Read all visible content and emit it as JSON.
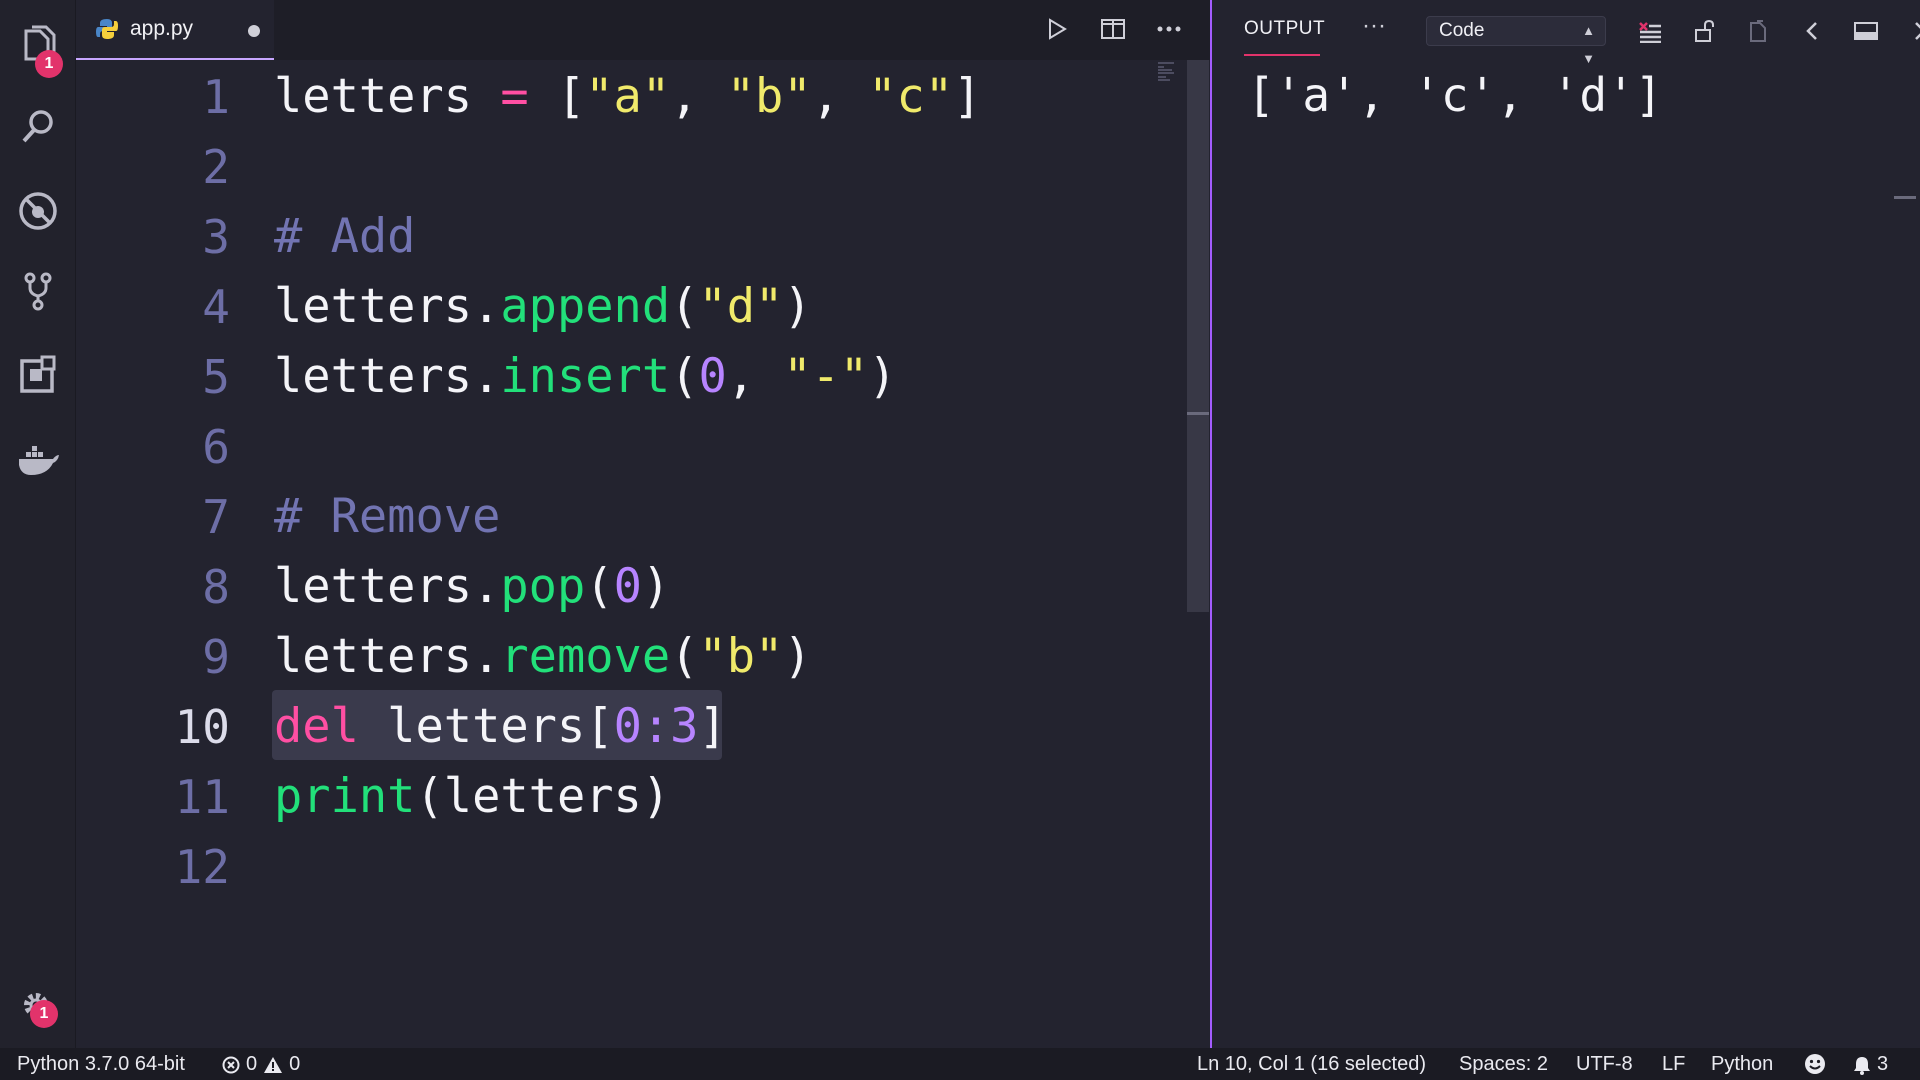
{
  "activity_bar": {
    "explorer_badge": "1",
    "settings_badge": "1",
    "items": [
      "files-icon",
      "search-icon",
      "debug-icon",
      "source-control-icon",
      "extensions-icon",
      "docker-icon"
    ]
  },
  "editor": {
    "tab_label": "app.py",
    "line_numbers": [
      "1",
      "2",
      "3",
      "4",
      "5",
      "6",
      "7",
      "8",
      "9",
      "10",
      "11",
      "12"
    ],
    "active_line": "10"
  },
  "panel": {
    "tab_label": "OUTPUT",
    "more": "···",
    "channel_selected": "Code",
    "output_text": "['a', 'c', 'd']"
  },
  "statusbar": {
    "interpreter": "Python 3.7.0 64-bit",
    "errors": "0",
    "warnings": "0",
    "position": "Ln 10, Col 1 (16 selected)",
    "spaces": "Spaces: 2",
    "encoding": "UTF-8",
    "eol": "LF",
    "language": "Python",
    "notifications": "3"
  },
  "colors": {
    "accent": "#a35cff",
    "badge": "#e2336b",
    "keyword": "#ff4fa3",
    "function": "#22e07a",
    "string": "#f0ea6b",
    "number": "#b784ff",
    "comment": "#7274b2"
  }
}
